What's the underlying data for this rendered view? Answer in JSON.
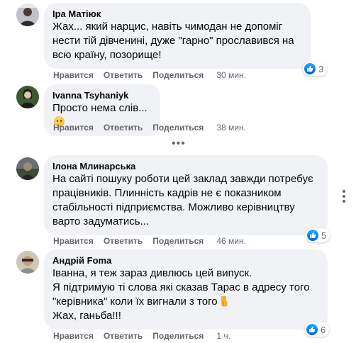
{
  "comments": [
    {
      "author": "Іра Матіюк",
      "text": "Жах... який нарцис, навіть чимодан не допоміг нести тій дівченині, дуже \"гарно\" прославився на всю країну, позорище!",
      "like_label": "Нравится",
      "reply_label": "Ответить",
      "share_label": "Поделиться",
      "time": "30 мин.",
      "reactions": "3"
    },
    {
      "author": "Ivanna Tsyhaniyk",
      "text": "Просто нема слів...",
      "emoji": "sad-face-emoji",
      "like_label": "Нравится",
      "reply_label": "Ответить",
      "share_label": "Поделиться",
      "time": "38 мин."
    },
    {
      "author": "Ілона Млинарська",
      "text": "На сайті пошуку роботи цей заклад завжди потребує працівників. Плинність кадрів не є показником стабільності підприємства. Можливо керівництву варто задуматись...",
      "like_label": "Нравится",
      "reply_label": "Ответить",
      "share_label": "Поделиться",
      "time": "46 мин.",
      "reactions": "5"
    },
    {
      "author": "Андрій Foma",
      "text": "Іванна, я теж зараз дивлюсь цей випуск.\nЯ підтримую ті слова які сказав Тарас в адресу того \"керівника\" коли їх вигнали з того",
      "text_end": "Жах, ганьба!!!",
      "emoji": "pointing-down-hand-emoji",
      "like_label": "Нравится",
      "reply_label": "Ответить",
      "share_label": "Поделиться",
      "time": "1 ч.",
      "reactions": "6"
    }
  ],
  "colors": {
    "bubble": "#f0f2f5",
    "secondary_text": "#65676b",
    "like_blue": "#0866ff"
  },
  "icons": {
    "more_replies": "ellipsis-icon",
    "options": "vertical-dots-icon",
    "reaction": "like-icon"
  }
}
